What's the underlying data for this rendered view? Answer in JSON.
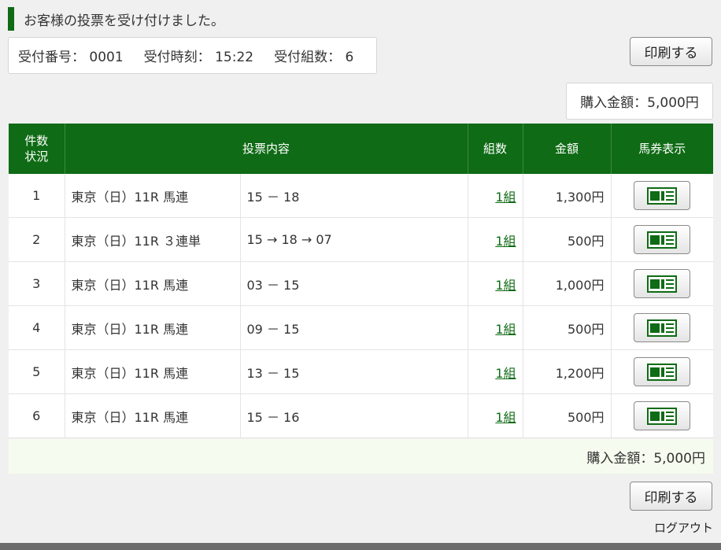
{
  "page": {
    "message": "お客様の投票を受け付けました。"
  },
  "receipt": {
    "number_label": "受付番号：",
    "number_value": "0001",
    "time_label": "受付時刻：",
    "time_value": "15:22",
    "sets_label": "受付組数：",
    "sets_value": "6"
  },
  "buttons": {
    "print_label": "印刷する",
    "logout_label": "ログアウト"
  },
  "total": {
    "label": "購入金額：",
    "value": "5,000円"
  },
  "table": {
    "headers": {
      "no_line1": "件数",
      "no_line2": "状況",
      "content": "投票内容",
      "sets": "組数",
      "amount": "金額",
      "ticket": "馬券表示"
    },
    "rows": [
      {
        "no": "1",
        "race": "東京（日）11R 馬連",
        "selection": "15 － 18",
        "sets": "1組",
        "amount": "1,300円"
      },
      {
        "no": "2",
        "race": "東京（日）11R ３連単",
        "selection": "15 → 18 → 07",
        "sets": "1組",
        "amount": "500円"
      },
      {
        "no": "3",
        "race": "東京（日）11R 馬連",
        "selection": "03 － 15",
        "sets": "1組",
        "amount": "1,000円"
      },
      {
        "no": "4",
        "race": "東京（日）11R 馬連",
        "selection": "09 － 15",
        "sets": "1組",
        "amount": "500円"
      },
      {
        "no": "5",
        "race": "東京（日）11R 馬連",
        "selection": "13 － 15",
        "sets": "1組",
        "amount": "1,200円"
      },
      {
        "no": "6",
        "race": "東京（日）11R 馬連",
        "selection": "15 － 16",
        "sets": "1組",
        "amount": "500円"
      }
    ]
  },
  "icons": {
    "ticket": "ticket-icon"
  },
  "colors": {
    "brand_green": "#0f6b15",
    "sum_row_bg": "#f6fbef"
  }
}
